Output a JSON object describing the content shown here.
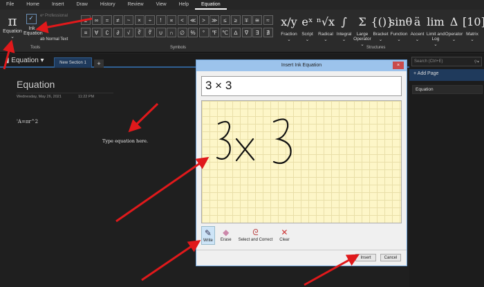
{
  "menu": [
    "File",
    "Home",
    "Insert",
    "Draw",
    "History",
    "Review",
    "View",
    "Help",
    "Equation"
  ],
  "tools": {
    "equation": "Equation",
    "ink_equation": "Ink Equation",
    "professional": "Professional",
    "normal_text": "Normal Text",
    "label": "Tools"
  },
  "symbols": {
    "row1": [
      "±",
      "∞",
      "=",
      "≠",
      "~",
      "×",
      "÷",
      "!",
      "∝",
      "<",
      "≪",
      ">",
      "≫",
      "≤",
      "≥",
      "∓",
      "≅",
      "≈"
    ],
    "row2": [
      "≡",
      "∀",
      "∁",
      "∂",
      "√",
      "∛",
      "∜",
      "∪",
      "∩",
      "∅",
      "%",
      "°",
      "℉",
      "℃",
      "∆",
      "∇",
      "∃",
      "∄"
    ],
    "label": "Symbols"
  },
  "structures": {
    "items": [
      {
        "g": "x/y",
        "l": "Fraction"
      },
      {
        "g": "eˣ",
        "l": "Script"
      },
      {
        "g": "ⁿ√x",
        "l": "Radical"
      },
      {
        "g": "∫",
        "l": "Integral"
      },
      {
        "g": "Σ",
        "l": "Large Operator"
      },
      {
        "g": "{()}",
        "l": "Bracket"
      },
      {
        "g": "sinθ",
        "l": "Function"
      },
      {
        "g": "ä",
        "l": "Accent"
      },
      {
        "g": "lim",
        "l": "Limit and Log"
      },
      {
        "g": "Δ",
        "l": "Operator"
      },
      {
        "g": "[10]",
        "l": "Matrix"
      }
    ],
    "label": "Structures"
  },
  "notebook": {
    "name": "Equation",
    "section": "New Section 1",
    "add": "+"
  },
  "page": {
    "title": "Equation",
    "date": "Wednesday, May 26, 2021",
    "time": "11:22 PM",
    "formula": "'A=πr^2",
    "placeholder": "Type equation here."
  },
  "search": {
    "placeholder": "Search (Ctrl+E)"
  },
  "pages": {
    "add": "Add Page",
    "items": [
      "Equation"
    ]
  },
  "dialog": {
    "title": "Insert Ink Equation",
    "close": "×",
    "result": "3 × 3",
    "tools": [
      {
        "icon": "✎",
        "l": "Write"
      },
      {
        "icon": "◆",
        "l": "Erase"
      },
      {
        "icon": "ᘓ",
        "l": "Select and Correct"
      },
      {
        "icon": "✕",
        "l": "Clear"
      }
    ],
    "insert": "Insert",
    "cancel": "Cancel"
  }
}
